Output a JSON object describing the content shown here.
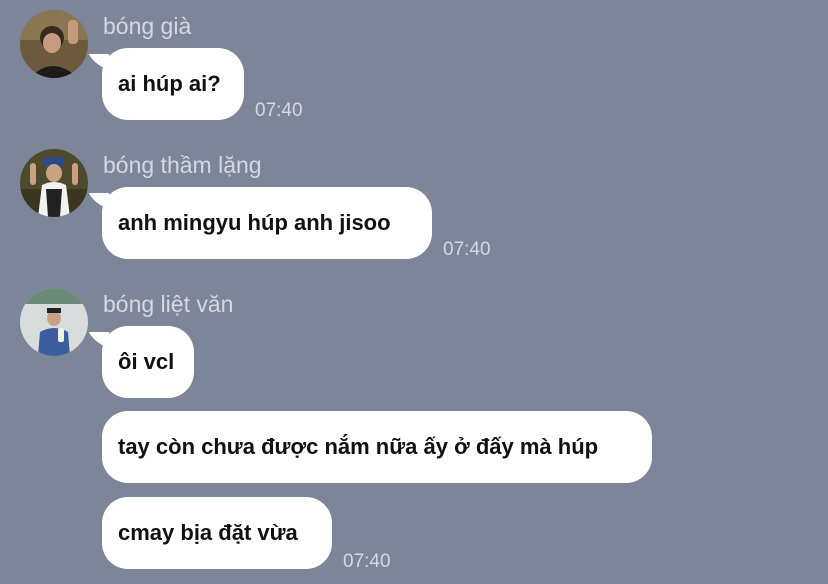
{
  "chat": {
    "groups": [
      {
        "sender": "bóng già",
        "avatar": "avatar-photo",
        "messages": [
          "ai húp ai?"
        ],
        "time": "07:40"
      },
      {
        "sender": "bóng thầm lặng",
        "avatar": "avatar-photo",
        "messages": [
          "anh mingyu húp anh jisoo"
        ],
        "time": "07:40"
      },
      {
        "sender": "bóng liệt văn",
        "avatar": "avatar-photo",
        "messages": [
          "ôi vcl",
          "tay còn chưa được nắm nữa ấy ở đấy mà húp",
          "cmay bịa đặt vừa"
        ],
        "time": "07:40"
      }
    ]
  }
}
